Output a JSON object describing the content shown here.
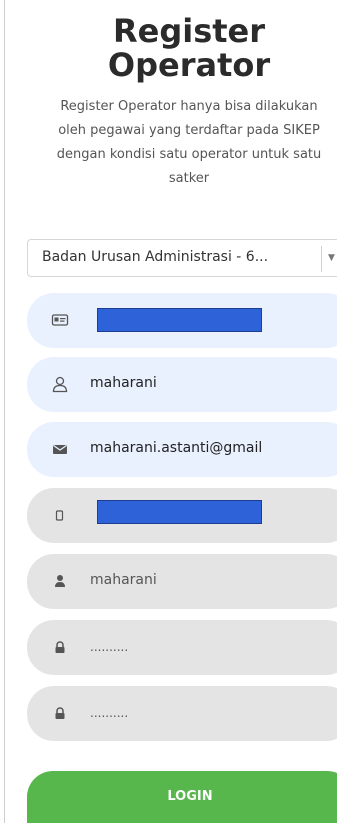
{
  "header": {
    "title_line1": "Register",
    "title_line2": "Operator"
  },
  "description": {
    "line1": "Register Operator hanya bisa dilakukan",
    "line2": "oleh pegawai yang terdaftar pada SIKEP",
    "line3": "dengan kondisi satu operator untuk satu",
    "line4": "satker"
  },
  "satker_select": {
    "selected": "Badan Urusan Administrasi - 6..."
  },
  "form": {
    "nip": {
      "value": "",
      "redacted": true,
      "icon": "id-card-icon"
    },
    "name": {
      "value": "maharani",
      "icon": "user-outline-icon"
    },
    "email": {
      "value": "maharani.astanti@gmail",
      "icon": "envelope-icon"
    },
    "phone": {
      "value": "",
      "redacted": true,
      "icon": "mobile-phone-icon"
    },
    "username": {
      "value": "maharani",
      "icon": "user-solid-icon"
    },
    "password": {
      "value": "..........",
      "icon": "lock-icon"
    },
    "password_confirm": {
      "value": "..........",
      "icon": "lock-icon"
    }
  },
  "login_button": {
    "label": "LOGIN"
  },
  "colors": {
    "field_blue": "#e9f1fe",
    "field_grey": "#e4e4e4",
    "login_green": "#57b64c",
    "redaction": "#2d62d8"
  }
}
